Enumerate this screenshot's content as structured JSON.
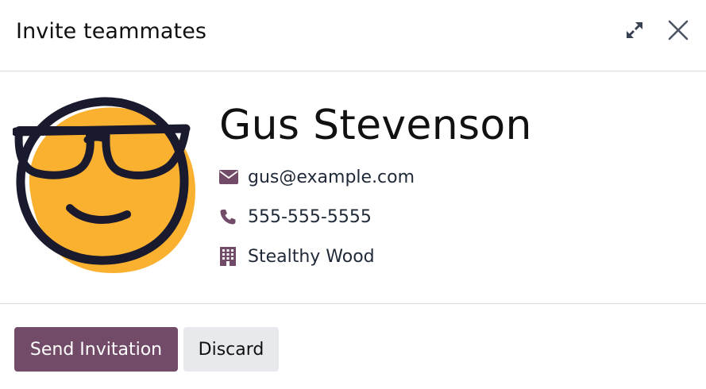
{
  "dialog": {
    "title": "Invite teammates",
    "expand_icon": "expand-icon",
    "close_icon": "close-icon"
  },
  "contact": {
    "avatar_icon": "smiley-sunglasses-avatar",
    "name": "Gus Stevenson",
    "email": "gus@example.com",
    "phone": "555-555-5555",
    "company": "Stealthy Wood",
    "email_icon": "envelope-icon",
    "phone_icon": "phone-icon",
    "company_icon": "building-icon"
  },
  "footer": {
    "send_label": "Send Invitation",
    "discard_label": "Discard"
  },
  "colors": {
    "primary": "#714b67",
    "secondary_bg": "#e7e9ed",
    "icon": "#714b67",
    "avatar_face": "#fbb130",
    "avatar_outline": "#1a1a2e"
  }
}
